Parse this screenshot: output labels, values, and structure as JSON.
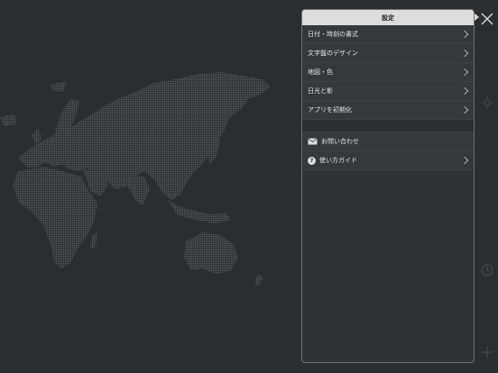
{
  "panel": {
    "title": "設定",
    "section1": [
      {
        "label": "日付・時刻の書式",
        "icon": "",
        "has_chevron": true
      },
      {
        "label": "文字盤のデザイン",
        "icon": "",
        "has_chevron": true
      },
      {
        "label": "地図・色",
        "icon": "",
        "has_chevron": true
      },
      {
        "label": "日光と影",
        "icon": "",
        "has_chevron": true
      },
      {
        "label": "アプリを初期化",
        "icon": "",
        "has_chevron": true
      }
    ],
    "section2": [
      {
        "label": "お問い合わせ",
        "icon": "mail-icon",
        "has_chevron": false
      },
      {
        "label": "使い方ガイド",
        "icon": "help-icon",
        "has_chevron": true
      }
    ]
  },
  "icons": {
    "close": "close-icon",
    "rail": [
      "sun-icon",
      "clock-icon",
      "add-icon"
    ]
  },
  "colors": {
    "background": "#2b2e31",
    "land_dots": "#5a5e62",
    "panel_header": "#dcdcdc"
  }
}
